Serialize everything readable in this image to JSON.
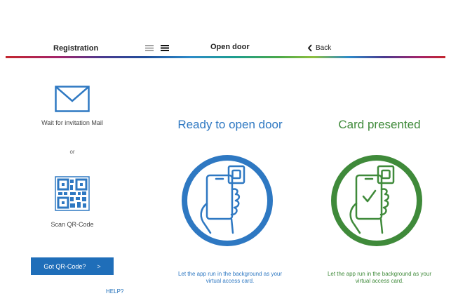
{
  "registration": {
    "title": "Registration",
    "mail_caption": "Wait for invitation Mail",
    "or_text": "or",
    "qr_caption": "Scan QR-Code",
    "button_label": "Got QR-Code?",
    "button_chevron": ">",
    "help_link": "HELP?"
  },
  "header": {
    "menu_icons": [
      "menu-outline-icon",
      "menu-filled-icon"
    ],
    "open_door_title": "Open door",
    "back_label": "Back"
  },
  "ready_panel": {
    "headline": "Ready to open door",
    "message": "Let the app run in the background as your virtual access card.",
    "color": "#2e78c2"
  },
  "presented_panel": {
    "headline": "Card presented",
    "message": "Let the app run in the background as your virtual access card.",
    "color": "#3f8a3a"
  },
  "colors": {
    "primary_button": "#1f6eb9",
    "link": "#1f6eb9",
    "mail_icon": "#2e78c2"
  }
}
